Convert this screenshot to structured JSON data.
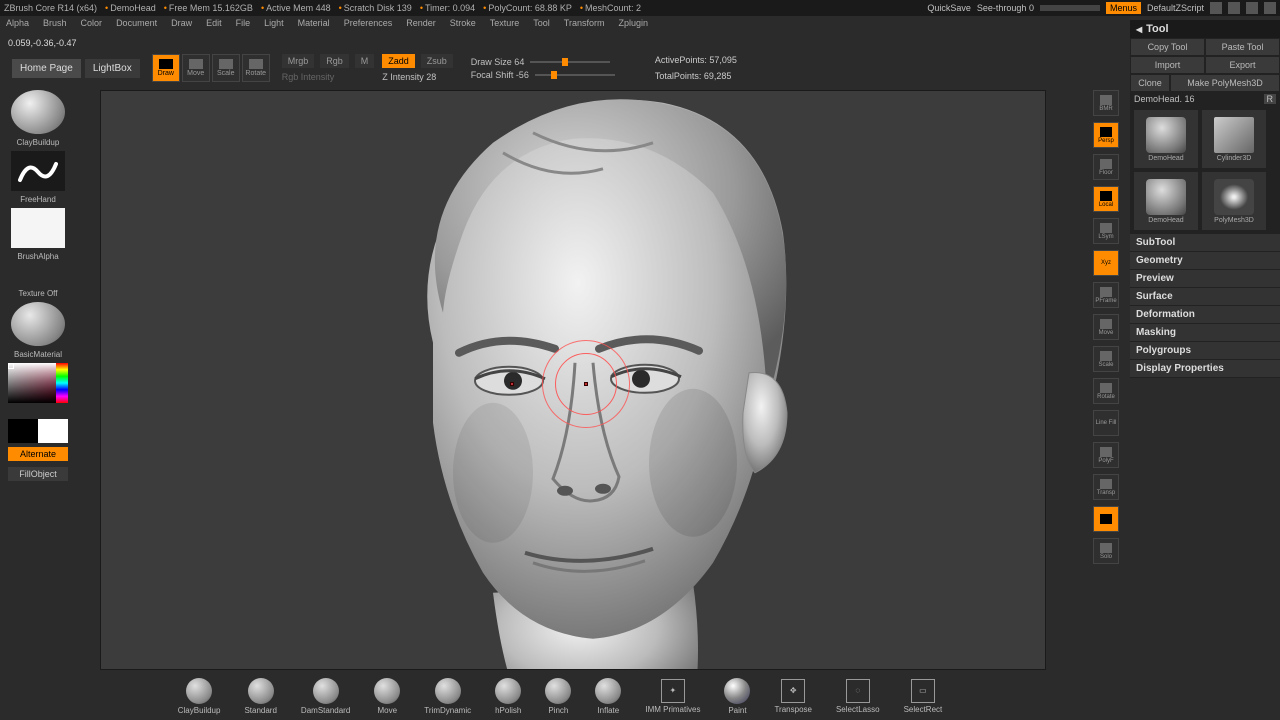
{
  "titlebar": {
    "app": "ZBrush Core R14 (x64)",
    "doc": "DemoHead",
    "freemem": "Free Mem 15.162GB",
    "activemem": "Active Mem 448",
    "scratch": "Scratch Disk 139",
    "timer": "Timer: 0.094",
    "polycount": "PolyCount: 68.88 KP",
    "meshcount": "MeshCount: 2",
    "quicksave": "QuickSave",
    "seethrough": "See-through  0",
    "menus": "Menus",
    "script": "DefaultZScript"
  },
  "menus": [
    "Alpha",
    "Brush",
    "Color",
    "Document",
    "Draw",
    "Edit",
    "File",
    "Light",
    "Material",
    "Preferences",
    "Render",
    "Stroke",
    "Texture",
    "Tool",
    "Transform",
    "Zplugin"
  ],
  "coords": "0.059,-0.36,-0.47",
  "toolbar": {
    "homepage": "Home Page",
    "lightbox": "LightBox",
    "modes": [
      "Draw",
      "Move",
      "Scale",
      "Rotate"
    ],
    "mrgb": "Mrgb",
    "rgb": "Rgb",
    "m": "M",
    "zadd": "Zadd",
    "zsub": "Zsub",
    "rgbint": "Rgb Intensity",
    "zint": "Z Intensity 28",
    "drawsize": "Draw Size 64",
    "focal": "Focal Shift -56",
    "active_pts": "ActivePoints: 57,095",
    "total_pts": "TotalPoints: 69,285"
  },
  "left": {
    "brush": "ClayBuildup",
    "stroke": "FreeHand",
    "alpha": "BrushAlpha",
    "texture": "Texture Off",
    "material": "BasicMaterial",
    "alternate": "Alternate",
    "fill": "FillObject"
  },
  "right_btns": [
    "BMR",
    "Persp",
    "Floor",
    "Local",
    "LSym",
    "Xyz",
    "PFrame",
    "Move",
    "Scale",
    "Rotate",
    "Line Fill",
    "PolyF",
    "Transp",
    "",
    "Solo"
  ],
  "right_active": [
    false,
    true,
    false,
    true,
    false,
    true,
    false,
    false,
    false,
    false,
    false,
    false,
    false,
    true,
    false
  ],
  "tool": {
    "title": "Tool",
    "copy": "Copy Tool",
    "paste": "Paste Tool",
    "import": "Import",
    "export": "Export",
    "clone": "Clone",
    "makepm": "Make PolyMesh3D",
    "name": "DemoHead. 16",
    "r": "R",
    "thumbs": [
      "DemoHead",
      "Cylinder3D",
      "DemoHead",
      "PolyMesh3D"
    ],
    "sections": [
      "SubTool",
      "Geometry",
      "Preview",
      "Surface",
      "Deformation",
      "Masking",
      "Polygroups",
      "Display Properties"
    ]
  },
  "bottom": [
    "ClayBuildup",
    "Standard",
    "DamStandard",
    "Move",
    "TrimDynamic",
    "hPolish",
    "Pinch",
    "Inflate",
    "IMM Primatives",
    "Paint",
    "Transpose",
    "SelectLasso",
    "SelectRect"
  ]
}
